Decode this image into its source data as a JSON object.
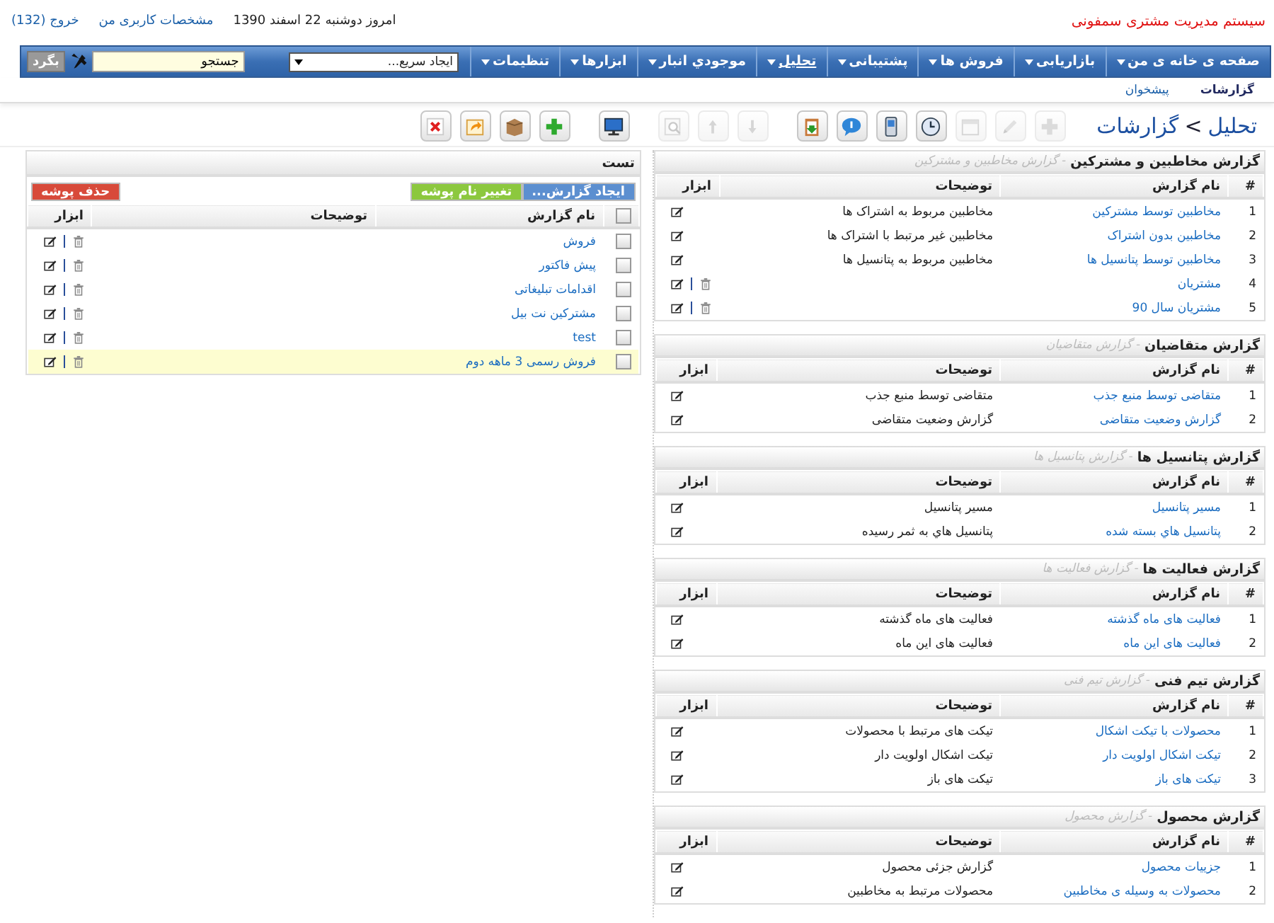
{
  "header": {
    "app_title": "سیستم مدیریت مشتری سمفونی",
    "date": "امروز دوشنبه 22 اسفند 1390",
    "profile_link": "مشخصات کاربری من",
    "logout_link": "خروج (132)"
  },
  "nav": {
    "items": [
      {
        "label": "صفحه ی خانه ی من",
        "selected": false
      },
      {
        "label": "بازاریابی",
        "selected": false
      },
      {
        "label": "فروش ها",
        "selected": false
      },
      {
        "label": "پشتیبانی",
        "selected": false
      },
      {
        "label": "تحلیل",
        "selected": true
      },
      {
        "label": "موجودي انبار",
        "selected": false
      },
      {
        "label": "ابزارها",
        "selected": false
      },
      {
        "label": "تنظیمات",
        "selected": false
      }
    ],
    "quick_create": {
      "value": "ایجاد سریع..."
    },
    "search": {
      "value": "جستجو",
      "button": "بگرد"
    }
  },
  "subnav": [
    {
      "label": "گزارشات",
      "selected": true
    },
    {
      "label": "پیشخوان",
      "selected": false
    }
  ],
  "breadcrumb": {
    "parent": "تحلیل",
    "separator": ">",
    "current": "گزارشات"
  },
  "toolbar": [
    {
      "kind": "plus",
      "disabled": true
    },
    {
      "kind": "pencil",
      "disabled": true
    },
    {
      "kind": "calendar",
      "disabled": true
    },
    {
      "kind": "clock",
      "disabled": false
    },
    {
      "kind": "phone",
      "disabled": false
    },
    {
      "kind": "chat",
      "disabled": false
    },
    {
      "kind": "clipboard",
      "disabled": false
    },
    {
      "kind": "down",
      "disabled": true
    },
    {
      "kind": "up",
      "disabled": true
    },
    {
      "kind": "find",
      "disabled": true
    },
    {
      "kind": "monitor",
      "disabled": false
    },
    {
      "kind": "add",
      "disabled": false
    },
    {
      "kind": "box",
      "disabled": false
    },
    {
      "kind": "redo",
      "disabled": false
    },
    {
      "kind": "delete",
      "disabled": false
    }
  ],
  "report_groups": {
    "groups": [
      {
        "title": "گزارش مخاطبین و مشترکین",
        "subtitle": "- گزارش مخاطبین و مشترکین",
        "columns": [
          "#",
          "نام گزارش",
          "توضیحات",
          "ابزار"
        ],
        "rows": [
          {
            "num": "1",
            "name": "مخاطبین توسط مشترکین",
            "description": "مخاطبین مربوط به اشتراک ها",
            "deletable": false
          },
          {
            "num": "2",
            "name": "مخاطبین بدون اشتراک",
            "description": "مخاطبین غیر مرتبط با اشتراک ها",
            "deletable": false
          },
          {
            "num": "3",
            "name": "مخاطبین توسط پتانسیل ها",
            "description": "مخاطبین مربوط به پتانسیل ها",
            "deletable": false
          },
          {
            "num": "4",
            "name": "مشتریان",
            "deletable": true
          },
          {
            "num": "5",
            "name": "مشتریان سال 90",
            "deletable": true
          }
        ]
      },
      {
        "title": "گزارش متقاضیان",
        "subtitle": "- گزارش متقاضیان",
        "columns": [
          "#",
          "نام گزارش",
          "توضیحات",
          "ابزار"
        ],
        "rows": [
          {
            "num": "1",
            "name": "متقاضی توسط منبع جذب",
            "description": "متقاضی توسط منبع جذب",
            "deletable": false
          },
          {
            "num": "2",
            "name": "گزارش وضعیت متقاضی",
            "description": "گزارش وضعیت متقاضی",
            "deletable": false
          }
        ]
      },
      {
        "title": "گزارش پتانسیل ها",
        "subtitle": "- گزارش پتانسیل ها",
        "columns": [
          "#",
          "نام گزارش",
          "توضیحات",
          "ابزار"
        ],
        "rows": [
          {
            "num": "1",
            "name": "مسیر پتانسیل",
            "description": "مسیر پتانسیل",
            "deletable": false
          },
          {
            "num": "2",
            "name": "پتانسیل هاي بسته شده",
            "description": "پتانسیل هاي به ثمر رسیده",
            "deletable": false
          }
        ]
      },
      {
        "title": "گزارش فعالیت ها",
        "subtitle": "- گزارش فعالیت ها",
        "columns": [
          "#",
          "نام گزارش",
          "توضیحات",
          "ابزار"
        ],
        "rows": [
          {
            "num": "1",
            "name": "فعالیت های ماه گذشته",
            "description": "فعالیت های ماه گذشته",
            "deletable": false
          },
          {
            "num": "2",
            "name": "فعالیت های این ماه",
            "description": "فعالیت های این ماه",
            "deletable": false
          }
        ]
      },
      {
        "title": "گزارش تیم فنی",
        "subtitle": "- گزارش تیم فنی",
        "columns": [
          "#",
          "نام گزارش",
          "توضیحات",
          "ابزار"
        ],
        "rows": [
          {
            "num": "1",
            "name": "محصولات با تیکت اشکال",
            "description": "تیکت های مرتبط با محصولات",
            "deletable": false
          },
          {
            "num": "2",
            "name": "تیکت اشکال اولویت دار",
            "description": "تیکت اشکال اولویت دار",
            "deletable": false
          },
          {
            "num": "3",
            "name": "تیکت های باز",
            "description": "تیکت های باز",
            "deletable": false
          }
        ]
      },
      {
        "title": "گزارش محصول",
        "subtitle": "- گزارش محصول",
        "columns": [
          "#",
          "نام گزارش",
          "توضیحات",
          "ابزار"
        ],
        "rows": [
          {
            "num": "1",
            "name": "جزییات محصول",
            "description": "گزارش جزئی محصول",
            "deletable": false
          },
          {
            "num": "2",
            "name": "محصولات به وسیله ی مخاطبین",
            "description": "محصولات مرتبط به مخاطبین",
            "deletable": false
          }
        ]
      }
    ]
  },
  "folder": {
    "title": "تست",
    "buttons": [
      {
        "kind": "create",
        "label": "ایجاد گزارش..."
      },
      {
        "kind": "rename",
        "label": "تغییر نام پوشه"
      },
      {
        "kind": "delete",
        "label": "حذف پوشه"
      }
    ],
    "select_all": {
      "checked": false
    },
    "columns": [
      "نام گزارش",
      "توضیحات",
      "ابزار"
    ],
    "rows": [
      {
        "name": "فروش",
        "checked": false,
        "highlighted": false
      },
      {
        "name": "پیش فاکتور",
        "checked": false,
        "highlighted": false
      },
      {
        "name": "اقدامات تبلیغاتی",
        "checked": false,
        "highlighted": false
      },
      {
        "name": "مشترکین نت بیل",
        "checked": false,
        "highlighted": false
      },
      {
        "name": "test",
        "checked": false,
        "highlighted": false
      },
      {
        "name": "فروش رسمی 3 ماهه دوم",
        "checked": false,
        "highlighted": true
      }
    ]
  }
}
